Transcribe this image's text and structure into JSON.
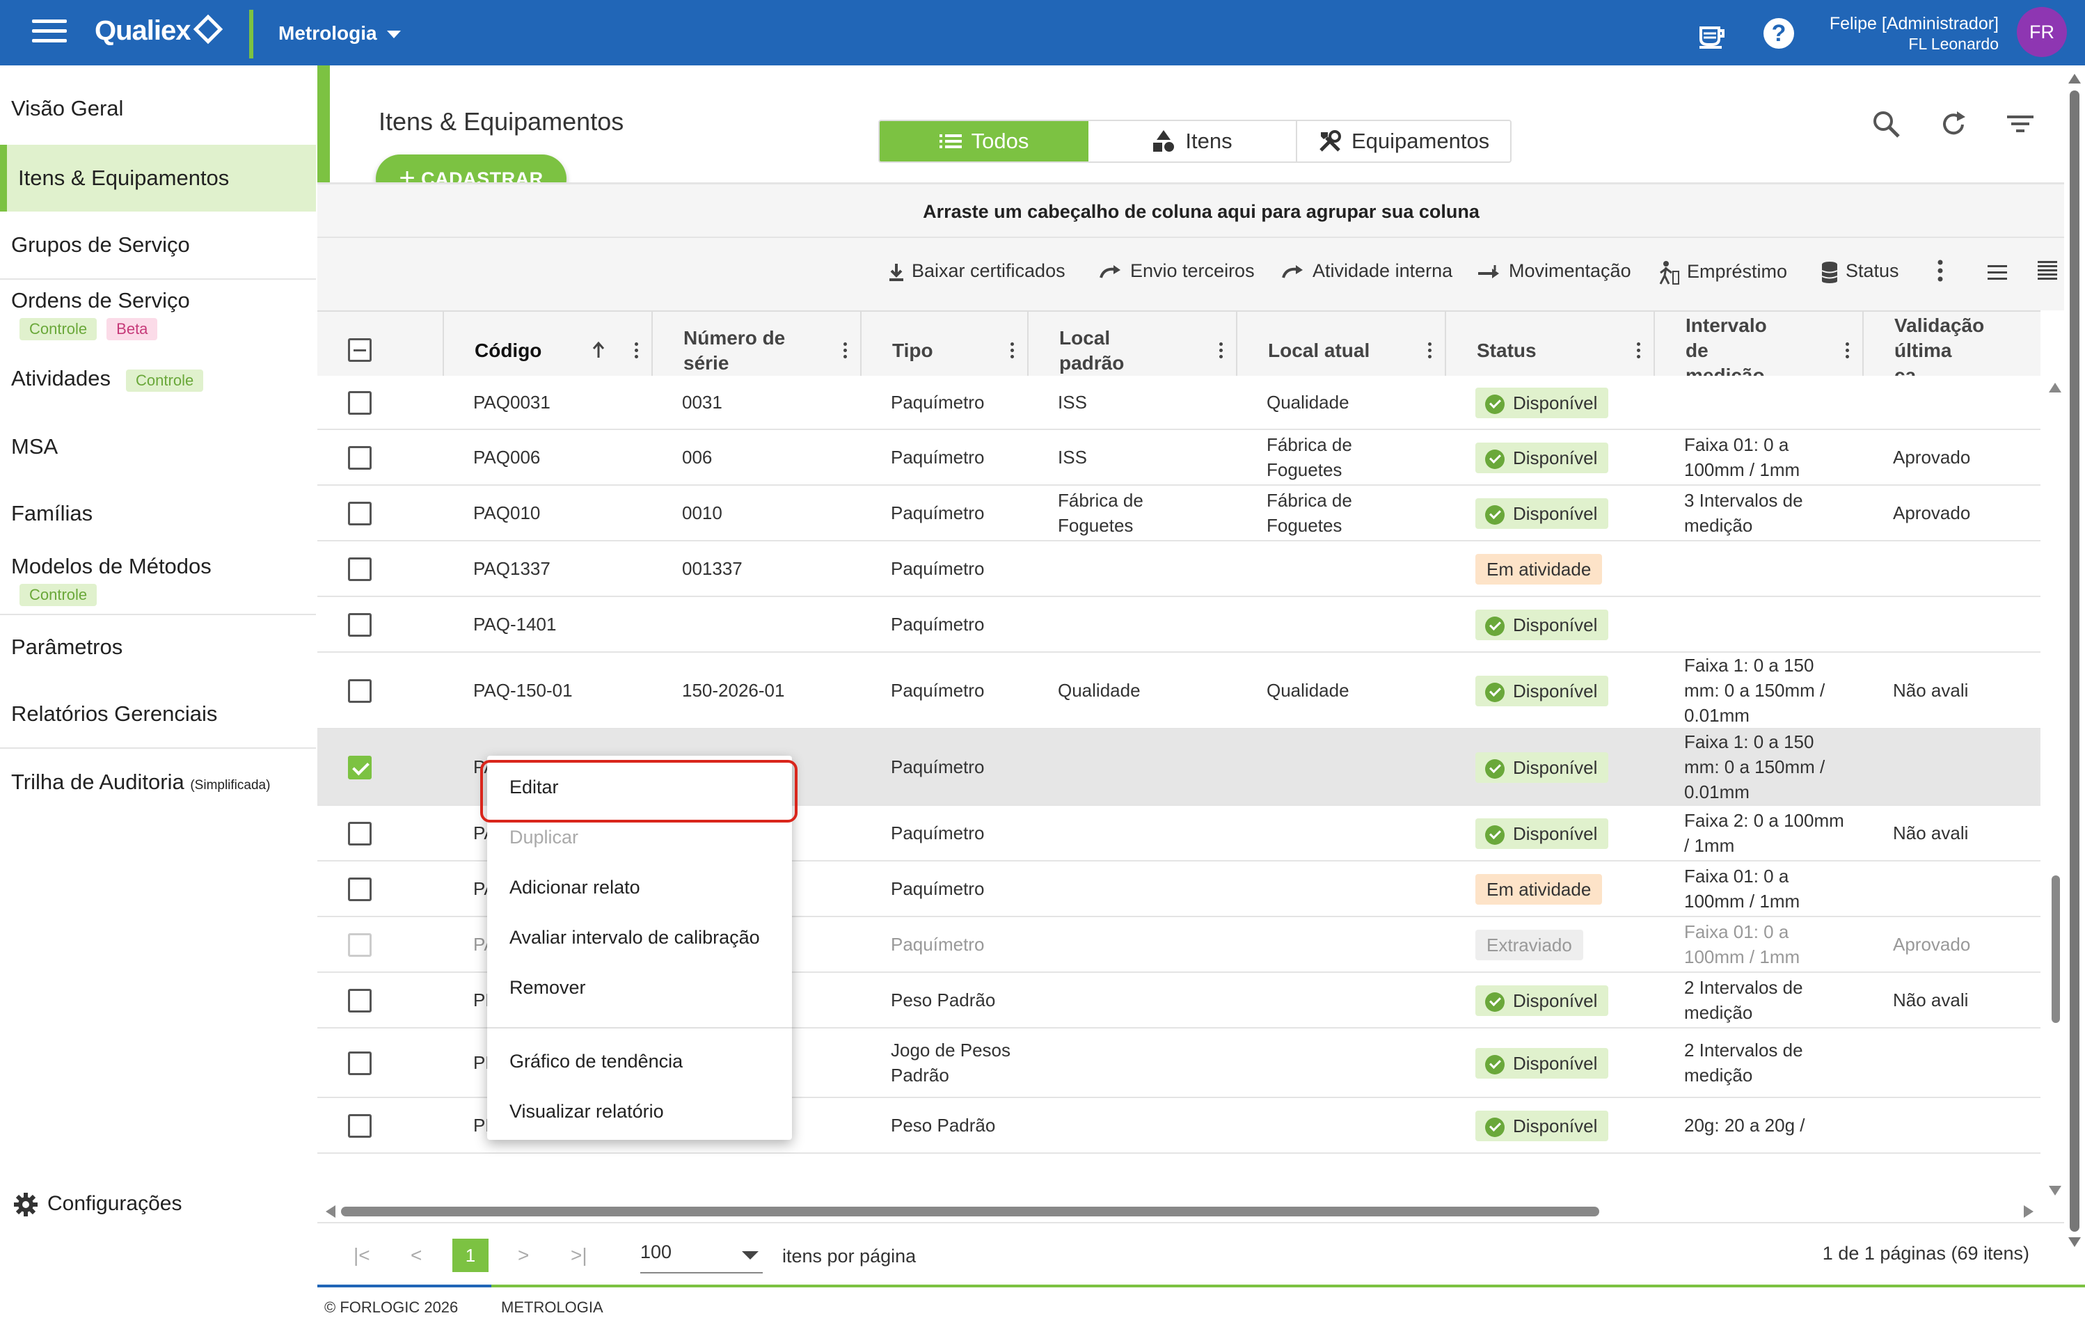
{
  "topbar": {
    "app_name": "Qualiex",
    "module": "Metrologia",
    "user_name": "Felipe [Administrador]",
    "user_sub": "FL Leonardo",
    "avatar_initials": "FR",
    "color": "#2166b7"
  },
  "sidebar": {
    "items": [
      {
        "label": "Visão Geral"
      },
      {
        "label": "Itens & Equipamentos"
      },
      {
        "label": "Grupos de Serviço"
      },
      {
        "label": "Ordens de Serviço",
        "badges": [
          "Controle",
          "Beta"
        ]
      },
      {
        "label": "Atividades",
        "badges": [
          "Controle"
        ]
      },
      {
        "label": "MSA"
      },
      {
        "label": "Famílias"
      },
      {
        "label": "Modelos de Métodos",
        "badges": [
          "Controle"
        ]
      },
      {
        "label": "Parâmetros"
      },
      {
        "label": "Relatórios Gerenciais"
      },
      {
        "label": "Trilha de Auditoria",
        "suffix": "(Simplificada)"
      }
    ],
    "settings": "Configurações",
    "accent": "#7cc242"
  },
  "page": {
    "title": "Itens & Equipamentos",
    "add_button": "CADASTRAR",
    "tabs": [
      "Todos",
      "Itens",
      "Equipamentos"
    ],
    "group_hint": "Arraste um cabeçalho de coluna aqui para agrupar sua coluna"
  },
  "toolbar": {
    "actions": [
      "Baixar certificados",
      "Envio terceiros",
      "Atividade interna",
      "Movimentação",
      "Empréstimo",
      "Status"
    ]
  },
  "table": {
    "columns": [
      "Código",
      "Número de série",
      "Tipo",
      "Local padrão",
      "Local atual",
      "Status",
      "Intervalo de medição",
      "Validação última ca"
    ],
    "rows": [
      {
        "codigo": "PAQ0031",
        "serie": "0031",
        "tipo": "Paquímetro",
        "local_padrao": "ISS",
        "local_atual": "Qualidade",
        "status": "Disponível",
        "intervalo": "",
        "validacao": ""
      },
      {
        "codigo": "PAQ006",
        "serie": "006",
        "tipo": "Paquímetro",
        "local_padrao": "ISS",
        "local_atual": "Fábrica de Foguetes",
        "status": "Disponível",
        "intervalo": "Faixa 01: 0 a 100mm / 1mm",
        "validacao": "Aprovado"
      },
      {
        "codigo": "PAQ010",
        "serie": "0010",
        "tipo": "Paquímetro",
        "local_padrao": "Fábrica de Foguetes",
        "local_atual": "Fábrica de Foguetes",
        "status": "Disponível",
        "intervalo": "3 Intervalos de medição",
        "validacao": "Aprovado"
      },
      {
        "codigo": "PAQ1337",
        "serie": "001337",
        "tipo": "Paquímetro",
        "local_padrao": "",
        "local_atual": "",
        "status": "Em atividade",
        "intervalo": "",
        "validacao": ""
      },
      {
        "codigo": "PAQ-1401",
        "serie": "",
        "tipo": "Paquímetro",
        "local_padrao": "",
        "local_atual": "",
        "status": "Disponível",
        "intervalo": "",
        "validacao": ""
      },
      {
        "codigo": "PAQ-150-01",
        "serie": "150-2026-01",
        "tipo": "Paquímetro",
        "local_padrao": "Qualidade",
        "local_atual": "Qualidade",
        "status": "Disponível",
        "intervalo": "Faixa 1: 0 a 150 mm: 0 a 150mm / 0.01mm",
        "validacao": "Não avali"
      },
      {
        "codigo": "PAQ-150-02",
        "serie": "",
        "tipo": "Paquímetro",
        "local_padrao": "",
        "local_atual": "",
        "status": "Disponível",
        "intervalo": "Faixa 1: 0 a 150 mm: 0 a 150mm / 0.01mm",
        "validacao": ""
      },
      {
        "codigo": "PA",
        "serie": "",
        "tipo": "Paquímetro",
        "local_padrao": "",
        "local_atual": "",
        "status": "Disponível",
        "intervalo": "Faixa 2: 0 a 100mm / 1mm",
        "validacao": "Não avali"
      },
      {
        "codigo": "PA",
        "serie": "",
        "tipo": "Paquímetro",
        "local_padrao": "",
        "local_atual": "",
        "status": "Em atividade",
        "intervalo": "Faixa 01: 0 a 100mm / 1mm",
        "validacao": ""
      },
      {
        "codigo": "PA",
        "serie": "",
        "tipo": "Paquímetro",
        "local_padrao": "",
        "local_atual": "",
        "status": "Extraviado",
        "intervalo": "Faixa 01: 0 a 100mm / 1mm",
        "validacao": "Aprovado"
      },
      {
        "codigo": "PE",
        "serie": "",
        "tipo": "Peso Padrão",
        "local_padrao": "",
        "local_atual": "",
        "status": "Disponível",
        "intervalo": "2 Intervalos de medição",
        "validacao": "Não avali"
      },
      {
        "codigo": "PE",
        "serie": "",
        "tipo": "Jogo de Pesos Padrão",
        "local_padrao": "",
        "local_atual": "",
        "status": "Disponível",
        "intervalo": "2 Intervalos de medição",
        "validacao": ""
      },
      {
        "codigo": "PE",
        "serie": "",
        "tipo": "Peso Padrão",
        "local_padrao": "",
        "local_atual": "",
        "status": "Disponível",
        "intervalo": "20g: 20 a 20g /",
        "validacao": ""
      }
    ]
  },
  "context_menu": {
    "items": [
      "Editar",
      "Duplicar",
      "Adicionar relato",
      "Avaliar intervalo de calibração",
      "Remover",
      "Gráfico de tendência",
      "Visualizar relatório"
    ]
  },
  "pager": {
    "current_page": "1",
    "per_page": "100",
    "per_page_label": "itens por página",
    "info": "1 de 1 páginas (69 itens)"
  },
  "footer": {
    "copyright": "© FORLOGIC 2026",
    "module": "METROLOGIA"
  }
}
